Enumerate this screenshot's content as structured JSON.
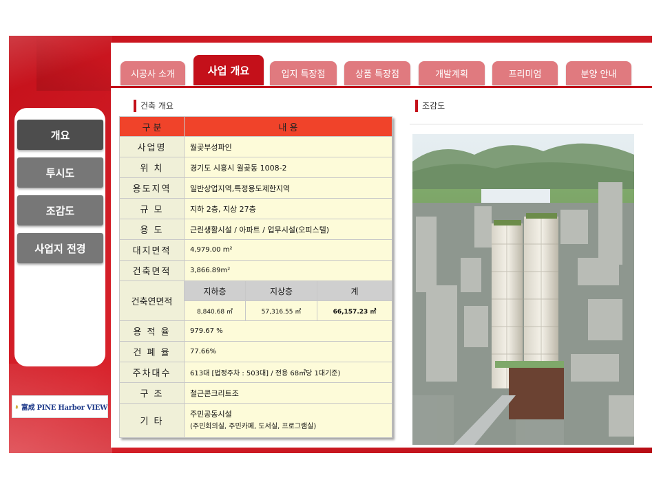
{
  "tabs": [
    {
      "label": "시공사 소개"
    },
    {
      "label": "사업 개요"
    },
    {
      "label": "입지 특장점"
    },
    {
      "label": "상품 특장점"
    },
    {
      "label": "개발계획"
    },
    {
      "label": "프리미엄"
    },
    {
      "label": "분양 안내"
    }
  ],
  "sidebar": {
    "items": [
      {
        "label": "개요"
      },
      {
        "label": "투시도"
      },
      {
        "label": "조감도"
      },
      {
        "label": "사업지 전경"
      }
    ]
  },
  "logo": {
    "text": "富成 PINE Harbor VIEW"
  },
  "overview": {
    "title": "건축 개요",
    "header": {
      "col1": "구       분",
      "col2": "내                          용"
    },
    "rows": [
      {
        "label": "사업명",
        "value": "월곶부성파인"
      },
      {
        "label": "위  치",
        "value": "경기도 시흥시 월곶동 1008-2"
      },
      {
        "label": "용도지역",
        "value": "일반상업지역,특정용도제한지역"
      },
      {
        "label": "규  모",
        "value": "지하 2층, 지상 27층"
      },
      {
        "label": "용  도",
        "value": "근린생활시설 / 아파트 / 업무시설(오피스텔)"
      },
      {
        "label": "대지면적",
        "value": "4,979.00 m²"
      },
      {
        "label": "건축면적",
        "value": "3,866.89m²"
      }
    ],
    "gfa": {
      "label": "건축연면적",
      "cols": [
        "지하층",
        "지상층",
        "계"
      ],
      "values": [
        "8,840.68 ㎡",
        "57,316.55 ㎡",
        "66,157.23 ㎡"
      ]
    },
    "rows2": [
      {
        "label": "용 적 율",
        "value": "979.67 %"
      },
      {
        "label": "건 폐 율",
        "value": "77.66%"
      },
      {
        "label": "주차대수",
        "value": "613대 [법정주차 : 503대] / 전용 68㎡당 1대기준)"
      },
      {
        "label": "구  조",
        "value": "철근콘크리트조"
      },
      {
        "label": "기  타",
        "value": "주민공동시설",
        "value2": "(주민회의실, 주민카페, 도서실, 프로그램실)"
      }
    ]
  },
  "aerial": {
    "title": "조감도"
  },
  "colors": {
    "brand_red": "#c4101a",
    "header_red": "#f0432a",
    "tab_pink": "#e07a7f",
    "side_gray": "#777777"
  }
}
